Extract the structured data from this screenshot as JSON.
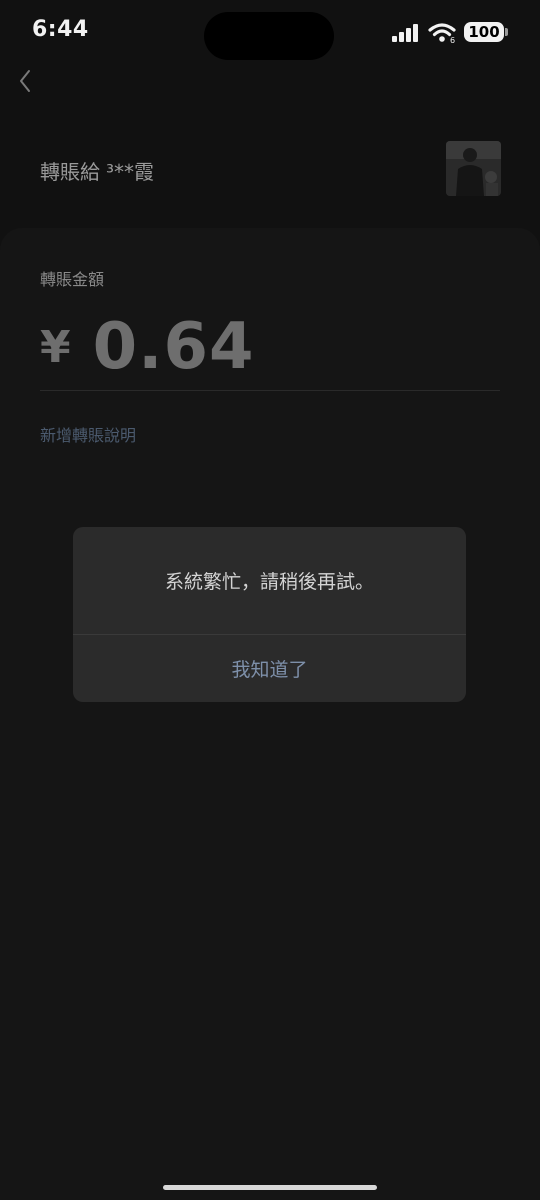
{
  "status_bar": {
    "time": "6:44",
    "battery": "100",
    "signal_icon": "cellular-signal-icon",
    "wifi_icon": "wifi-icon"
  },
  "nav": {
    "back_icon": "chevron-left-icon"
  },
  "transfer": {
    "label": "轉賬給",
    "recipient": "³**霞"
  },
  "form": {
    "amount_label": "轉賬金額",
    "currency": "¥",
    "amount": "0.64",
    "add_note": "新增轉賬說明"
  },
  "dialog": {
    "message": "系統繁忙，請稍後再試。",
    "button": "我知道了"
  },
  "colors": {
    "background": "#111111",
    "dialog": "#2b2b2b",
    "link": "#7e90aa"
  }
}
